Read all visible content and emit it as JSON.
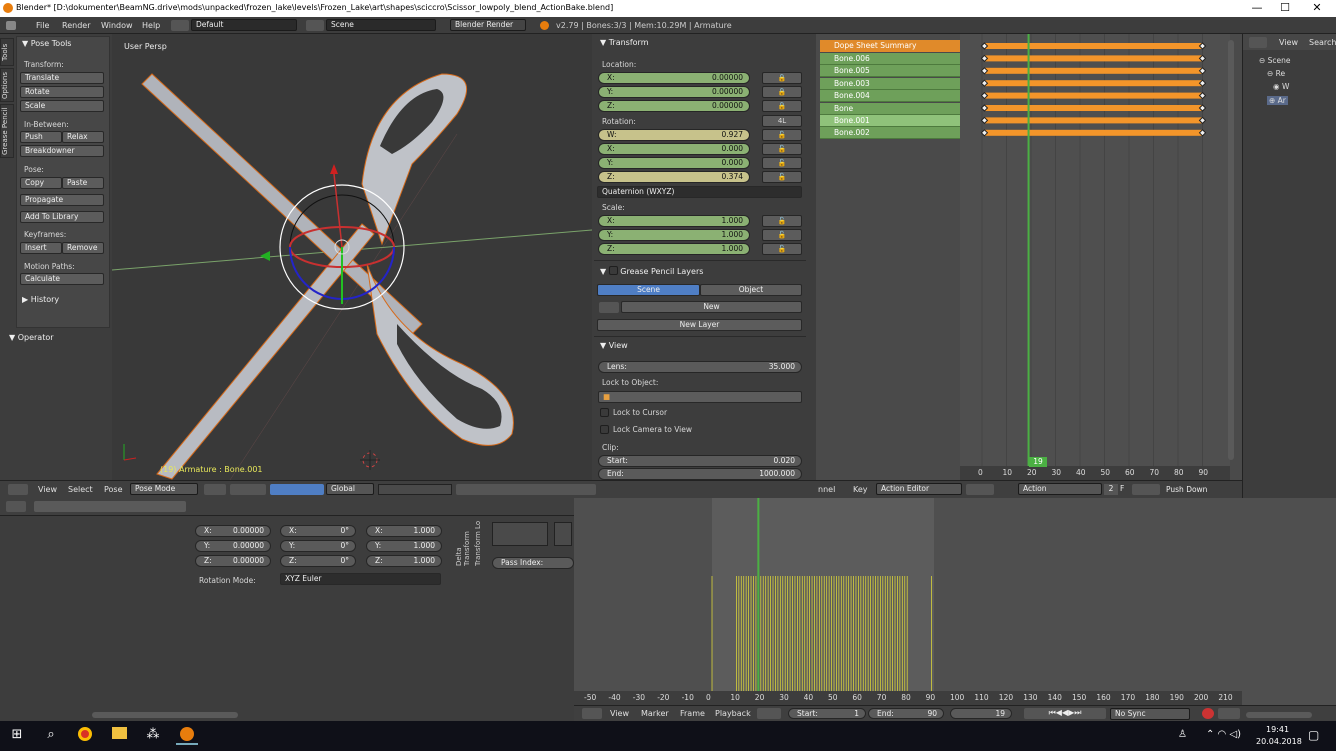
{
  "title_bar": {
    "title": "Blender* [D:\\dokumenter\\BeamNG.drive\\mods\\unpacked\\frozen_lake\\levels\\Frozen_Lake\\art\\shapes\\sciccro\\Scissor_lowpoly_blend_ActionBake.blend]",
    "minimize": "—",
    "maximize": "☐",
    "close": "✕"
  },
  "menu": {
    "items": [
      "File",
      "Render",
      "Window",
      "Help"
    ],
    "layout": "Default",
    "scene": "Scene",
    "engine": "Blender Render",
    "stats": "v2.79 | Bones:3/3 | Mem:10.29M | Armature"
  },
  "tool_shelf": {
    "vtabs": [
      "Tools",
      "Options",
      "Grease Pencil"
    ],
    "panel_title": "Pose Tools",
    "transform_label": "Transform:",
    "transform": [
      "Translate",
      "Rotate",
      "Scale"
    ],
    "inbetween_label": "In-Between:",
    "push": "Push",
    "relax": "Relax",
    "breakdowner": "Breakdowner",
    "pose_label": "Pose:",
    "copy": "Copy",
    "paste": "Paste",
    "propagate": "Propagate",
    "add_library": "Add To Library",
    "keyframes_label": "Keyframes:",
    "insert": "Insert",
    "remove": "Remove",
    "motion_label": "Motion Paths:",
    "calculate": "Calculate",
    "history": "History",
    "operator": "Operator"
  },
  "viewport": {
    "view_name": "User Persp",
    "object_info": "(19) Armature : Bone.001",
    "menus": [
      "View",
      "Select",
      "Pose"
    ],
    "mode": "Pose Mode",
    "orientation": "Global"
  },
  "properties": {
    "transform_title": "Transform",
    "location_label": "Location:",
    "location": [
      {
        "k": "X:",
        "v": "0.00000"
      },
      {
        "k": "Y:",
        "v": "0.00000"
      },
      {
        "k": "Z:",
        "v": "0.00000"
      }
    ],
    "rotation_label": "Rotation:",
    "rotation_lock": "4L",
    "rotation": [
      {
        "k": "W:",
        "v": "0.927"
      },
      {
        "k": "X:",
        "v": "0.000"
      },
      {
        "k": "Y:",
        "v": "0.000"
      },
      {
        "k": "Z:",
        "v": "0.374"
      }
    ],
    "rotation_mode": "Quaternion (WXYZ)",
    "scale_label": "Scale:",
    "scale": [
      {
        "k": "X:",
        "v": "1.000"
      },
      {
        "k": "Y:",
        "v": "1.000"
      },
      {
        "k": "Z:",
        "v": "1.000"
      }
    ],
    "gp_title": "Grease Pencil Layers",
    "gp_scene": "Scene",
    "gp_object": "Object",
    "gp_new": "New",
    "gp_new_layer": "New Layer",
    "view_title": "View",
    "lens_label": "Lens:",
    "lens": "35.000",
    "lock_object": "Lock to Object:",
    "lock_cursor": "Lock to Cursor",
    "lock_camera": "Lock Camera to View",
    "clip_label": "Clip:",
    "clip_start_label": "Start:",
    "clip_start": "0.020",
    "clip_end_label": "End:",
    "clip_end": "1000.000"
  },
  "dopesheet": {
    "channels": [
      "Dope Sheet Summary",
      "Bone.006",
      "Bone.005",
      "Bone.003",
      "Bone.004",
      "Bone",
      "Bone.001",
      "Bone.002"
    ],
    "frame_ticks": [
      "0",
      "10",
      "20",
      "30",
      "40",
      "50",
      "60",
      "70",
      "80",
      "90"
    ],
    "current_frame": "19",
    "header_menus": [
      "nnel",
      "Key"
    ],
    "editor_mode": "Action Editor",
    "action_label": "Action",
    "action_users": "2",
    "fake_user": "F",
    "push_down": "Push Down"
  },
  "outliner": {
    "view": "View",
    "search": "Search",
    "items": [
      "Scene",
      "Re",
      "W",
      "Ar"
    ]
  },
  "bottom_props": {
    "loc": [
      {
        "k": "X:",
        "v": "0.00000"
      },
      {
        "k": "Y:",
        "v": "0.00000"
      },
      {
        "k": "Z:",
        "v": "0.00000"
      }
    ],
    "rot": [
      {
        "k": "X:",
        "v": "0°"
      },
      {
        "k": "Y:",
        "v": "0°"
      },
      {
        "k": "Z:",
        "v": "0°"
      }
    ],
    "scl": [
      {
        "k": "X:",
        "v": "1.000"
      },
      {
        "k": "Y:",
        "v": "1.000"
      },
      {
        "k": "Z:",
        "v": "1.000"
      }
    ],
    "rotation_mode_label": "Rotation Mode:",
    "rotation_mode": "XYZ Euler",
    "vertical1": "Delta Transform",
    "vertical2": "Transform Lo",
    "pass_index": "Pass Index:"
  },
  "timeline": {
    "ticks": [
      "-50",
      "-40",
      "-30",
      "-20",
      "-10",
      "0",
      "10",
      "20",
      "30",
      "40",
      "50",
      "60",
      "70",
      "80",
      "90",
      "100",
      "110",
      "120",
      "130",
      "140",
      "150",
      "160",
      "170",
      "180",
      "190",
      "200",
      "210"
    ],
    "menus": [
      "View",
      "Marker",
      "Frame",
      "Playback"
    ],
    "start_label": "Start:",
    "start": "1",
    "end_label": "End:",
    "end": "90",
    "current": "19",
    "sync": "No Sync"
  },
  "taskbar": {
    "time": "19:41",
    "date": "20.04.2018"
  },
  "colors": {
    "accent_blue": "#4f7ec4",
    "orange": "#f3952a",
    "green_field": "#8bb173",
    "yellow_field": "#c7c28b",
    "current_frame": "#4bb043"
  }
}
